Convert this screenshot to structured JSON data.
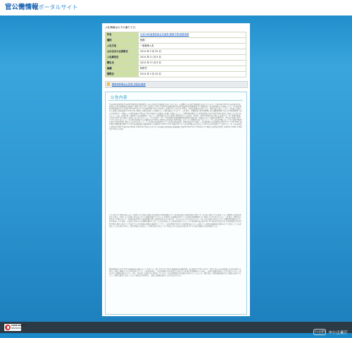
{
  "header": {
    "brand_main": "官公需情報",
    "brand_sub": "ポータルサイト"
  },
  "notice": "入札情報は以下の通りです。",
  "details": [
    {
      "label": "件名",
      "value": "平成26年度運営総合本道県(業務付帯)業務事業",
      "link": true
    },
    {
      "label": "種別",
      "value": "役務",
      "link": false
    },
    {
      "label": "入札方法",
      "value": "一般競争入札",
      "link": false
    },
    {
      "label": "公示日または更新日",
      "value": "2014 年 5 月 30 日",
      "link": false
    },
    {
      "label": "入札締切日",
      "value": "2014 年 11 月 8 日",
      "link": false
    },
    {
      "label": "開札日",
      "value": "2014 年 11 月 8 日",
      "link": false
    },
    {
      "label": "組織",
      "value": "特許庁",
      "link": false
    },
    {
      "label": "期限日",
      "value": "2014 年 5 月 30 日",
      "link": false
    }
  ],
  "attachment": {
    "label": "関係資料等は公告書_別記仕様書"
  },
  "content": {
    "title": "公告内容",
    "p1": "平成26年度運営総合本道県(業務付帯)業務事業 入札公告(総合評価落札方式) 次のとおり一般競争入札(総合評価落札方式)に付します。平成26年5月30日 支出負担行為担当官 特許庁総務部会計課長 1 競争入札に付する事項 (1) 件名 平成26年度運営総合本道県(業務付帯)業務事業 (2) 業務内容 入札説明書及び仕様書による。(3) 履行期間 契約締結日から平成27年3月31日まで (4) 履行場所 特許庁が指定する場所 (5) 入札方法 本件は、総合評価落札方式とする。落札決定に当たっては、入札書に記載された金額に当該金額の100分の8に相当する額を加算した金額をもって落札価格とするので、入札者は、消費税及び地方消費税に係る課税事業者であるか免税事業者であるかを問わず、見積もった契約金額の108分の100に相当する金額を入札書に記載すること。2 競争参加資格 (1) 予算決算及び会計令第70条の規定に該当しない者であること。なお、未成年者、被保佐人又は被補助人であって、契約締結のために必要な同意を得ている者は、同条中、特別の理由がある場合に該当する。(2) 予算決算及び会計令第71条の規定に該当しない者であること。(3) 平成25・26・27年度経済産業省競争参加資格(全省庁統一資格)において役務の提供等のA、B又はC等級に格付けされた者であること。(4) 経済産業省からの補助金交付等停止措置又は指名停止措置が講じられている期間中の者でないこと。(5) 入札説明書において示す暴力団排除に関する誓約事項に誓約できる者であること。3 入札書の提出場所等 (1) 入札書の提出場所、契約条項を示す場所、入札説明書の交付場所及び問合せ先 〒100-8915 東京都千代田区霞が関3-4-3 特許庁総務部会計課契約第一班 電話03-3581-1101 内線2161 (2) 入札説明書の交付方法 上記3(1)の交付場所にて交付する。(3) 入札説明会の日時及び場所 平成26年6月6日 10時00分 特許庁庁舎 (4) 入札書及び提案書の受領期限 平成26年6月27日 17時00分 (5) 開札の日時及び場所 平成26年7月8日 14時00分 特許庁入札室",
    "p2": "4 その他 (1) 契約手続において使用する言語及び通貨 日本語及び日本国通貨 (2) 入札保証金及び契約保証金 免除 (3) 入札者に要求される事項 この一般競争に参加を希望する者は、封印した入札書に本公告に示した業務を履行できることを証明する書類を添付して入札書の受領期限までに提出しなければならない。入札者は、開札日の前日までの間において、契約担当官等から当該書類に関し説明を求められた場合は、それに応じなければならない。(4) 入札の無効 本公告に示した競争参加資格のない者の提出した入札書、入札者に求められる義務を履行しなかった者の提出した入札書は無効とする。(5) 契約書作成の要否 要 (6) 落札者の決定方法 予算決算及び会計令第79条の規定に基づいて作成された予定価格の制限の範囲内で、かつ、入札説明書で指定する要求事項のうち、必須とした項目の最低限の要求をすべて満たしている提案をした入札者の中から、総合評価の方法をもって落札者を定める。(7) 手続における交渉の有無 無 (8) その他 詳細は入札説明書による。",
    "p3": "関係資料等の交付 特許庁総務部会計課において交付する。問い合わせ先 特許庁総務部会計課契約第一班 電話03-3581-1101。本件に係る入札説明書の交付を希望する者は、事前に連絡のうえ交付を受けること。入札参加者は、入札説明書の交付を受けた日から入札書の受領期限までの間に、必要な書類を提出しなければならない。提出された書類は返却しない。なお、本公告に記載のない事項については、入札説明書及び仕様書の定めるところによる。落札者は、契約締結後速やかに業務に着手すること。契約の履行に当たっては、関係法令を遵守し、誠実に業務を遂行しなければならない。"
  },
  "footer": {
    "cc_line1": "SOME RIGHTS",
    "cc_line2": "RESERVED",
    "agency_seal": "中小企業庁",
    "agency_name": "中小企業庁"
  }
}
